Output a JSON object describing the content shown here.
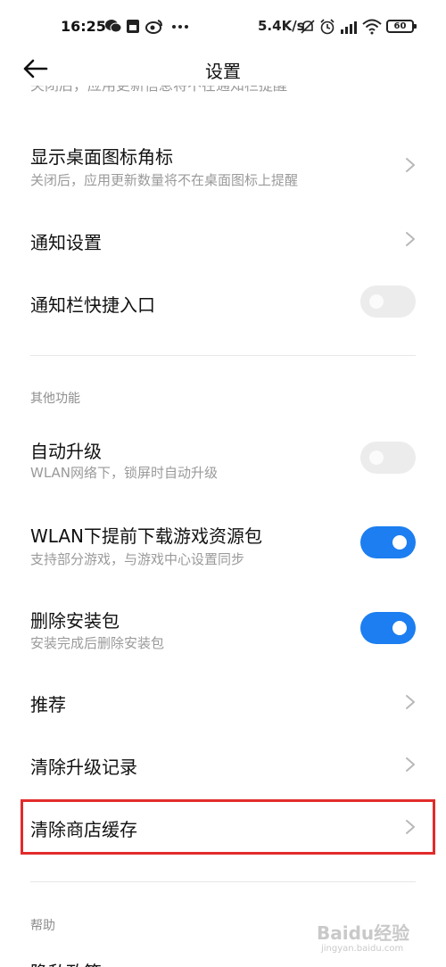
{
  "status_bar": {
    "time": "16:25",
    "net_speed": "5.4K/s",
    "battery": "60",
    "icons": [
      "wechat-icon",
      "sim-icon",
      "weibo-icon",
      "more-dots-icon",
      "mute-icon",
      "alarm-icon",
      "signal-icon",
      "wifi-icon",
      "battery-icon"
    ]
  },
  "header": {
    "title": "设置",
    "back_icon": "back-arrow-icon"
  },
  "clipped_subtitle": "关闭后，应用更新信息将不在通知栏提醒",
  "settings": {
    "desktop_badge": {
      "title": "显示桌面图标角标",
      "subtitle": "关闭后，应用更新数量将不在桌面图标上提醒"
    },
    "notification_settings": {
      "title": "通知设置"
    },
    "notification_shortcut": {
      "title": "通知栏快捷入口",
      "enabled": false
    }
  },
  "other_features": {
    "header": "其他功能",
    "auto_upgrade": {
      "title": "自动升级",
      "subtitle": "WLAN网络下，锁屏时自动升级",
      "enabled": false
    },
    "wlan_preload": {
      "title": "WLAN下提前下载游戏资源包",
      "subtitle": "支持部分游戏，与游戏中心设置同步",
      "enabled": true
    },
    "delete_package": {
      "title": "删除安装包",
      "subtitle": "安装完成后删除安装包",
      "enabled": true
    },
    "recommend": {
      "title": "推荐"
    },
    "clear_upgrade_records": {
      "title": "清除升级记录"
    },
    "clear_store_cache": {
      "title": "清除商店缓存",
      "highlighted": true
    }
  },
  "help": {
    "header": "帮助",
    "privacy_policy": {
      "title": "隐私政策"
    }
  },
  "watermark": {
    "text": "Baidu经验",
    "sub": "jingyan.baidu.com"
  },
  "colors": {
    "toggle_on": "#1c7ef0",
    "toggle_off": "#ececec",
    "highlight": "#e22b2b"
  }
}
